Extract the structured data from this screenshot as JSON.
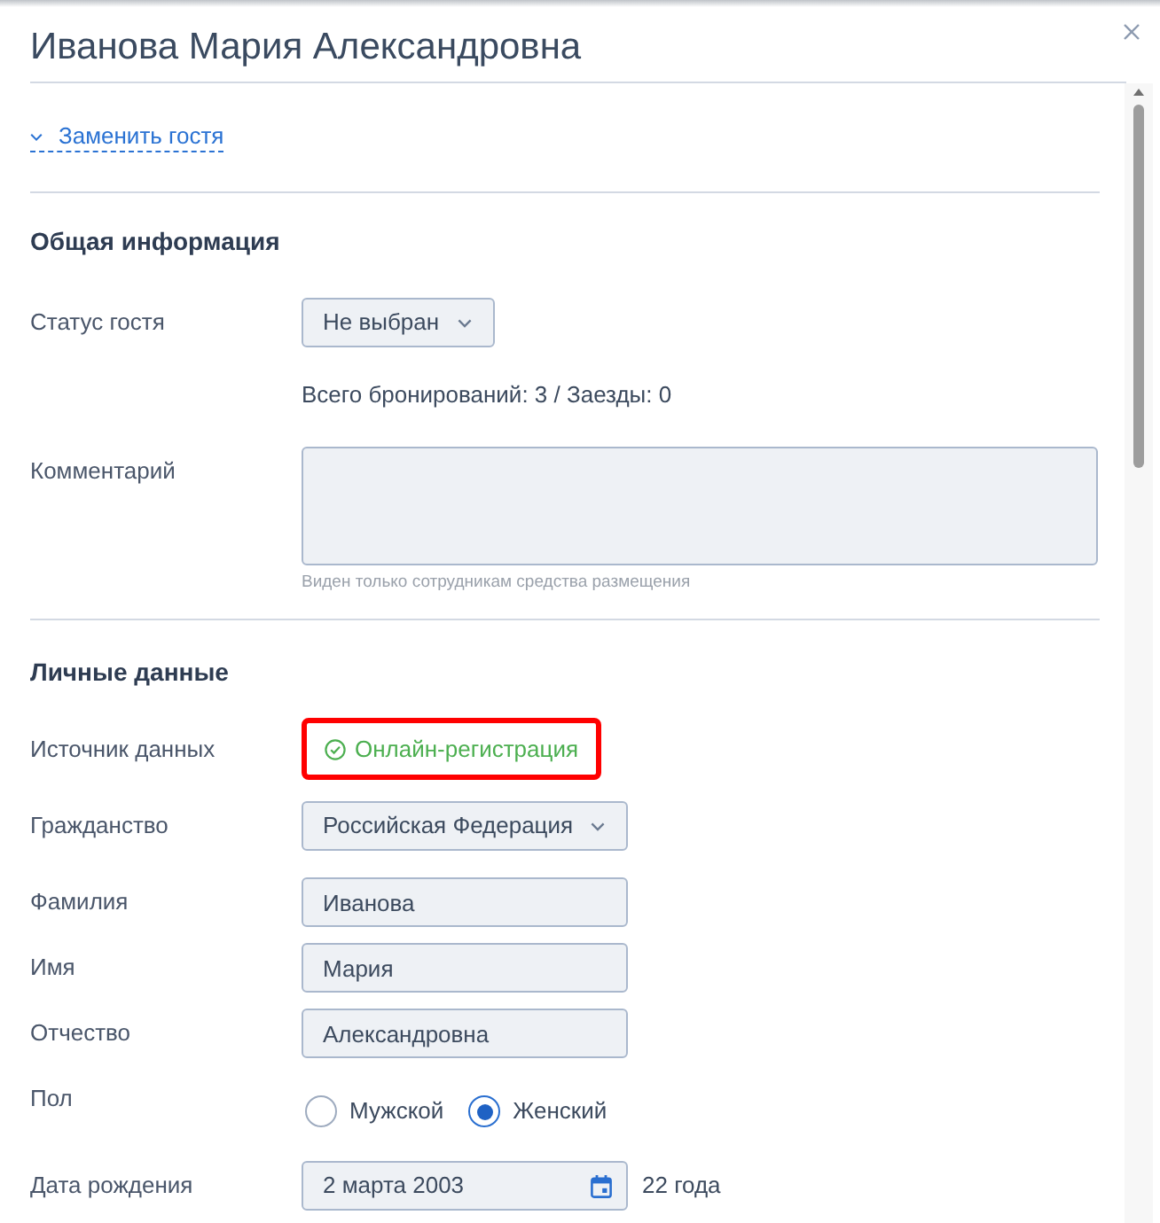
{
  "window": {
    "title": "Иванова Мария Александровна"
  },
  "replace_guest_link": {
    "label": "Заменить гостя",
    "expanded": false
  },
  "sections": [
    {
      "title": "Общая информация",
      "fields": [
        {
          "kind": "select",
          "label": "Статус гостя",
          "value": "Не выбран"
        },
        {
          "kind": "note",
          "text": "Всего бронирований: 3 / Заезды: 0"
        },
        {
          "kind": "textarea",
          "label": "Комментарий",
          "hint": "Виден только сотрудникам средства размещения"
        }
      ]
    },
    {
      "title": "Личные данные",
      "fields": [
        {
          "kind": "status",
          "label": "Источник данных",
          "value": "Онлайн-регистрация",
          "highlighted": true
        },
        {
          "kind": "select",
          "label": "Гражданство",
          "value": "Российская Федерация"
        },
        {
          "kind": "input",
          "label": "Фамилия",
          "value": "Иванова"
        },
        {
          "kind": "input",
          "label": "Имя",
          "value": "Мария"
        },
        {
          "kind": "input",
          "label": "Отчество",
          "value": "Александровна"
        },
        {
          "kind": "radio",
          "label": "Пол",
          "options": [
            {
              "label": "Мужской",
              "selected": false
            },
            {
              "label": "Женский",
              "selected": true
            }
          ]
        },
        {
          "kind": "date",
          "label": "Дата рождения",
          "value": "2 марта 2003",
          "age": "22 года"
        }
      ]
    }
  ]
}
